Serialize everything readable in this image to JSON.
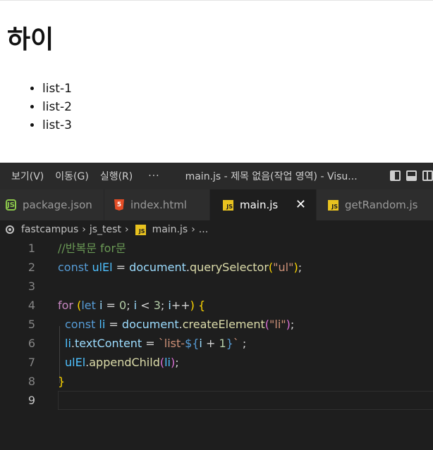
{
  "page": {
    "heading": "하이",
    "list_items": [
      "list-1",
      "list-2",
      "list-3"
    ]
  },
  "titlebar": {
    "menu": [
      "보기(V)",
      "이동(G)",
      "실행(R)"
    ],
    "more": "···",
    "window_title": "main.js - 제목 없음(작업 영역) - Visu..."
  },
  "tabs": [
    {
      "label": "package.json",
      "icon": "nodejs-icon"
    },
    {
      "label": "index.html",
      "icon": "html5-icon"
    },
    {
      "label": "main.js",
      "icon": "js-file-icon",
      "active": true
    },
    {
      "label": "getRandom.js",
      "icon": "js-file-icon"
    }
  ],
  "breadcrumb": {
    "items": [
      "fastcampus",
      "js_test",
      "main.js",
      "..."
    ]
  },
  "editor": {
    "line_numbers": [
      "1",
      "2",
      "3",
      "4",
      "5",
      "6",
      "7",
      "8",
      "9"
    ],
    "current_line": "9",
    "code": {
      "l1_comment": "//반복문 for문",
      "l2_const": "const",
      "l2_var": "ulEl",
      "l2_eq": " = ",
      "l2_obj": "document",
      "l2_dot": ".",
      "l2_fn": "querySelector",
      "l2_open": "(",
      "l2_str": "\"ul\"",
      "l2_close": ")",
      "l2_semi": ";",
      "l4_for": "for",
      "l4_open": " (",
      "l4_let": "let",
      "l4_i": " i",
      "l4_eq": " = ",
      "l4_zero": "0",
      "l4_semi1": "; ",
      "l4_i2": "i",
      "l4_lt": " < ",
      "l4_three": "3",
      "l4_semi2": "; ",
      "l4_i3": "i",
      "l4_inc": "++",
      "l4_close": ")",
      "l4_brace": " {",
      "l5_const": "const",
      "l5_li": " li",
      "l5_eq": " = ",
      "l5_obj": "document",
      "l5_dot": ".",
      "l5_fn": "createElement",
      "l5_open": "(",
      "l5_str": "\"li\"",
      "l5_close": ")",
      "l5_semi": ";",
      "l6_li": "li",
      "l6_dot": ".",
      "l6_prop": "textContent",
      "l6_eq": " = ",
      "l6_tpl_start": "`list-",
      "l6_interp_open": "${",
      "l6_i": "i",
      "l6_plus": " + ",
      "l6_one": "1",
      "l6_interp_close": "}",
      "l6_tpl_end": "`",
      "l6_semi": " ;",
      "l7_var": "ulEl",
      "l7_dot": ".",
      "l7_fn": "appendChild",
      "l7_open": "(",
      "l7_li": "li",
      "l7_close": ")",
      "l7_semi": ";",
      "l8_brace": "}"
    }
  },
  "colors": {
    "editor_bg": "#1e1e1e",
    "tab_active_bg": "#1e1e1e",
    "tab_inactive_bg": "#2d2d2d",
    "js_icon": "#e8c21f",
    "html_icon": "#e44d26",
    "node_icon": "#8cc84b"
  }
}
